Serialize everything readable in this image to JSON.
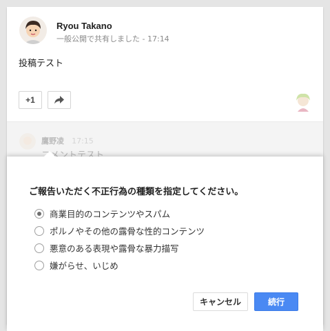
{
  "post": {
    "author": "Ryou Takano",
    "visibility": "一般公開で共有しました",
    "separator": "-",
    "time": "17:14",
    "body": "投稿テスト",
    "plus_one": "+1"
  },
  "comment": {
    "author": "鷹野凌",
    "time": "17:15",
    "text": "コメントテスト"
  },
  "report_dialog": {
    "title": "ご報告いただく不正行為の種類を指定してください。",
    "options": [
      {
        "label": "商業目的のコンテンツやスパム",
        "selected": true
      },
      {
        "label": "ポルノやその他の露骨な性的コンテンツ",
        "selected": false
      },
      {
        "label": "悪意のある表現や露骨な暴力描写",
        "selected": false
      },
      {
        "label": "嫌がらせ、いじめ",
        "selected": false
      }
    ],
    "cancel_label": "キャンセル",
    "continue_label": "続行"
  },
  "colors": {
    "accent": "#4a89f3",
    "background": "#e5e5e5"
  },
  "icons": {
    "share": "share-arrow-icon"
  }
}
